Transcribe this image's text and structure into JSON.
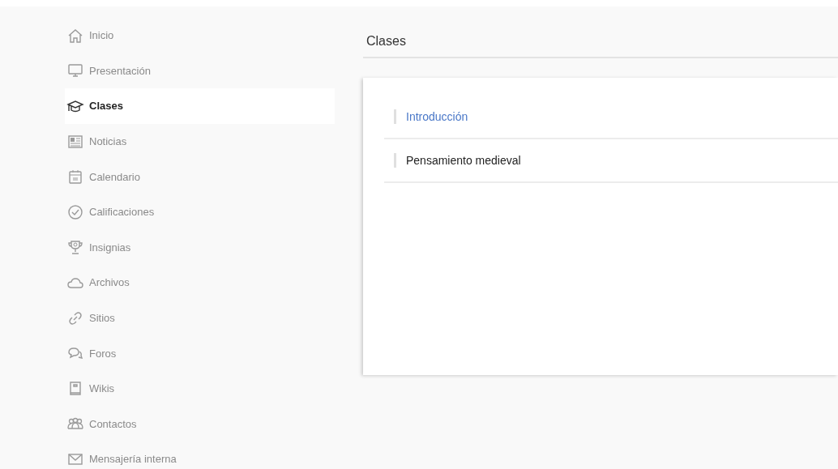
{
  "sidebar": {
    "items": [
      {
        "label": "Inicio",
        "selected": false
      },
      {
        "label": "Presentación",
        "selected": false
      },
      {
        "label": "Clases",
        "selected": true
      },
      {
        "label": "Noticias",
        "selected": false
      },
      {
        "label": "Calendario",
        "selected": false
      },
      {
        "label": "Calificaciones",
        "selected": false
      },
      {
        "label": "Insignias",
        "selected": false
      },
      {
        "label": "Archivos",
        "selected": false
      },
      {
        "label": "Sitios",
        "selected": false
      },
      {
        "label": "Foros",
        "selected": false
      },
      {
        "label": "Wikis",
        "selected": false
      },
      {
        "label": "Contactos",
        "selected": false
      },
      {
        "label": "Mensajería interna",
        "selected": false
      }
    ]
  },
  "main": {
    "title": "Clases",
    "lessons": [
      {
        "title": "Introducción",
        "selected": true
      },
      {
        "title": "Pensamiento medieval",
        "selected": false
      }
    ]
  }
}
